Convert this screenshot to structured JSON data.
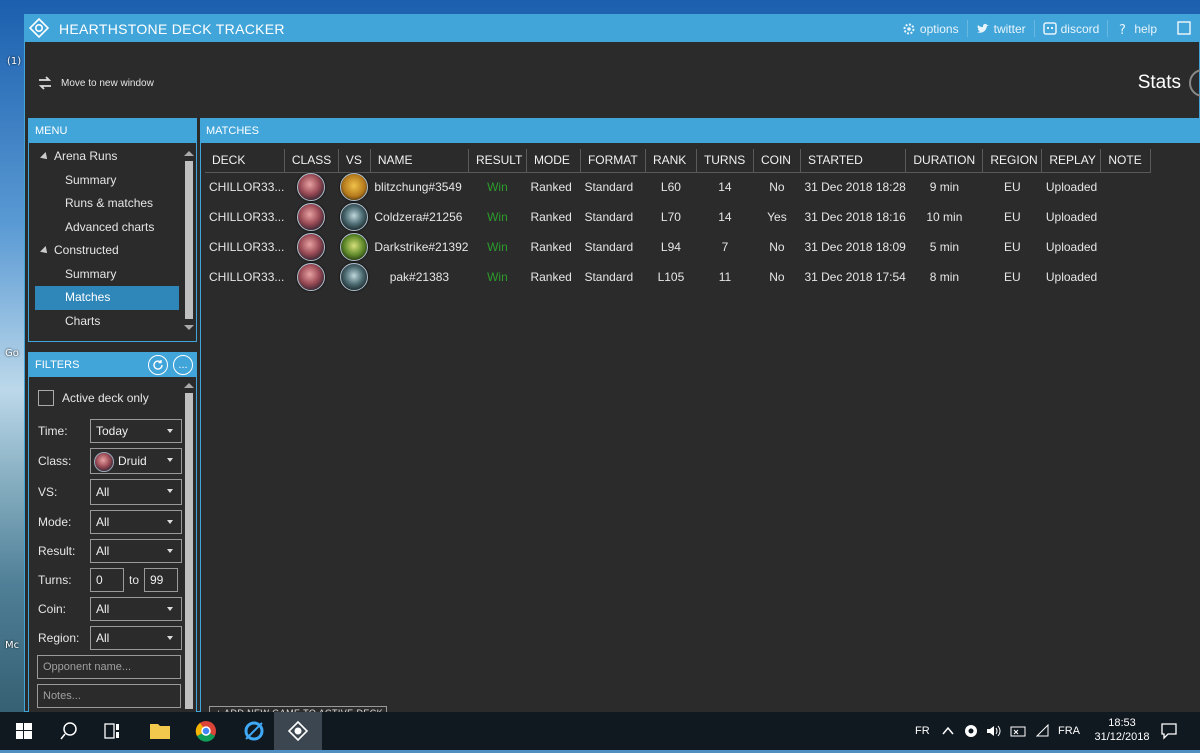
{
  "window": {
    "title": "HEARTHSTONE DECK TRACKER",
    "links": [
      "options",
      "twitter",
      "discord",
      "help"
    ],
    "move_label": "Move to new window",
    "page_title": "Stats"
  },
  "desktop": {
    "side_labels": [
      "(1)",
      "Go",
      "Mc"
    ]
  },
  "menu": {
    "header": "MENU",
    "items": [
      {
        "label": "Arena Runs",
        "kind": "group"
      },
      {
        "label": "Summary",
        "kind": "sub"
      },
      {
        "label": "Runs & matches",
        "kind": "sub"
      },
      {
        "label": "Advanced charts",
        "kind": "sub"
      },
      {
        "label": "Constructed",
        "kind": "group"
      },
      {
        "label": "Summary",
        "kind": "sub"
      },
      {
        "label": "Matches",
        "kind": "sel"
      },
      {
        "label": "Charts",
        "kind": "sub"
      }
    ]
  },
  "filters": {
    "header": "FILTERS",
    "refresh_icon": "refresh-icon",
    "more_label": "...",
    "active_deck_label": "Active deck only",
    "time_label": "Time:",
    "time_value": "Today",
    "class_label": "Class:",
    "class_value": "Druid",
    "vs_label": "VS:",
    "vs_value": "All",
    "mode_label": "Mode:",
    "mode_value": "All",
    "result_label": "Result:",
    "result_value": "All",
    "turns_label": "Turns:",
    "turns_min": "0",
    "turns_to": "to",
    "turns_max": "99",
    "coin_label": "Coin:",
    "coin_value": "All",
    "region_label": "Region:",
    "region_value": "All",
    "opponent_placeholder": "Opponent name...",
    "notes_placeholder": "Notes..."
  },
  "matches": {
    "header": "MATCHES",
    "columns": [
      "DECK",
      "CLASS",
      "VS",
      "NAME",
      "RESULT",
      "MODE",
      "FORMAT",
      "RANK",
      "TURNS",
      "COIN",
      "STARTED",
      "DURATION",
      "REGION",
      "REPLAY",
      "NOTE"
    ],
    "rows": [
      {
        "deck": "CHILLOR33...",
        "class": "druid",
        "vs": "shaman",
        "name": "blitzchung#3549",
        "result": "Win",
        "mode": "Ranked",
        "format": "Standard",
        "rank": "L60",
        "turns": "14",
        "coin": "No",
        "started": "31 Dec 2018 18:28",
        "duration": "9 min",
        "region": "EU",
        "replay": "Uploaded",
        "note": ""
      },
      {
        "deck": "CHILLOR33...",
        "class": "druid",
        "vs": "rogue",
        "name": "Coldzera#21256",
        "result": "Win",
        "mode": "Ranked",
        "format": "Standard",
        "rank": "L70",
        "turns": "14",
        "coin": "Yes",
        "started": "31 Dec 2018 18:16",
        "duration": "10 min",
        "region": "EU",
        "replay": "Uploaded",
        "note": ""
      },
      {
        "deck": "CHILLOR33...",
        "class": "druid",
        "vs": "hunter",
        "name": "Darkstrike#21392",
        "result": "Win",
        "mode": "Ranked",
        "format": "Standard",
        "rank": "L94",
        "turns": "7",
        "coin": "No",
        "started": "31 Dec 2018 18:09",
        "duration": "5 min",
        "region": "EU",
        "replay": "Uploaded",
        "note": ""
      },
      {
        "deck": "CHILLOR33...",
        "class": "druid",
        "vs": "rogue",
        "name": "pak#21383",
        "result": "Win",
        "mode": "Ranked",
        "format": "Standard",
        "rank": "L105",
        "turns": "11",
        "coin": "No",
        "started": "31 Dec 2018 17:54",
        "duration": "8 min",
        "region": "EU",
        "replay": "Uploaded",
        "note": ""
      }
    ],
    "add_button": "+ ADD NEW GAME TO ACTIVE DECK"
  },
  "taskbar": {
    "lang": "FR",
    "lang2": "FRA",
    "time": "18:53",
    "date": "31/12/2018"
  },
  "colors": {
    "accent": "#41a5d9",
    "win": "#2c9b2c",
    "panel": "#2b2b2b"
  }
}
